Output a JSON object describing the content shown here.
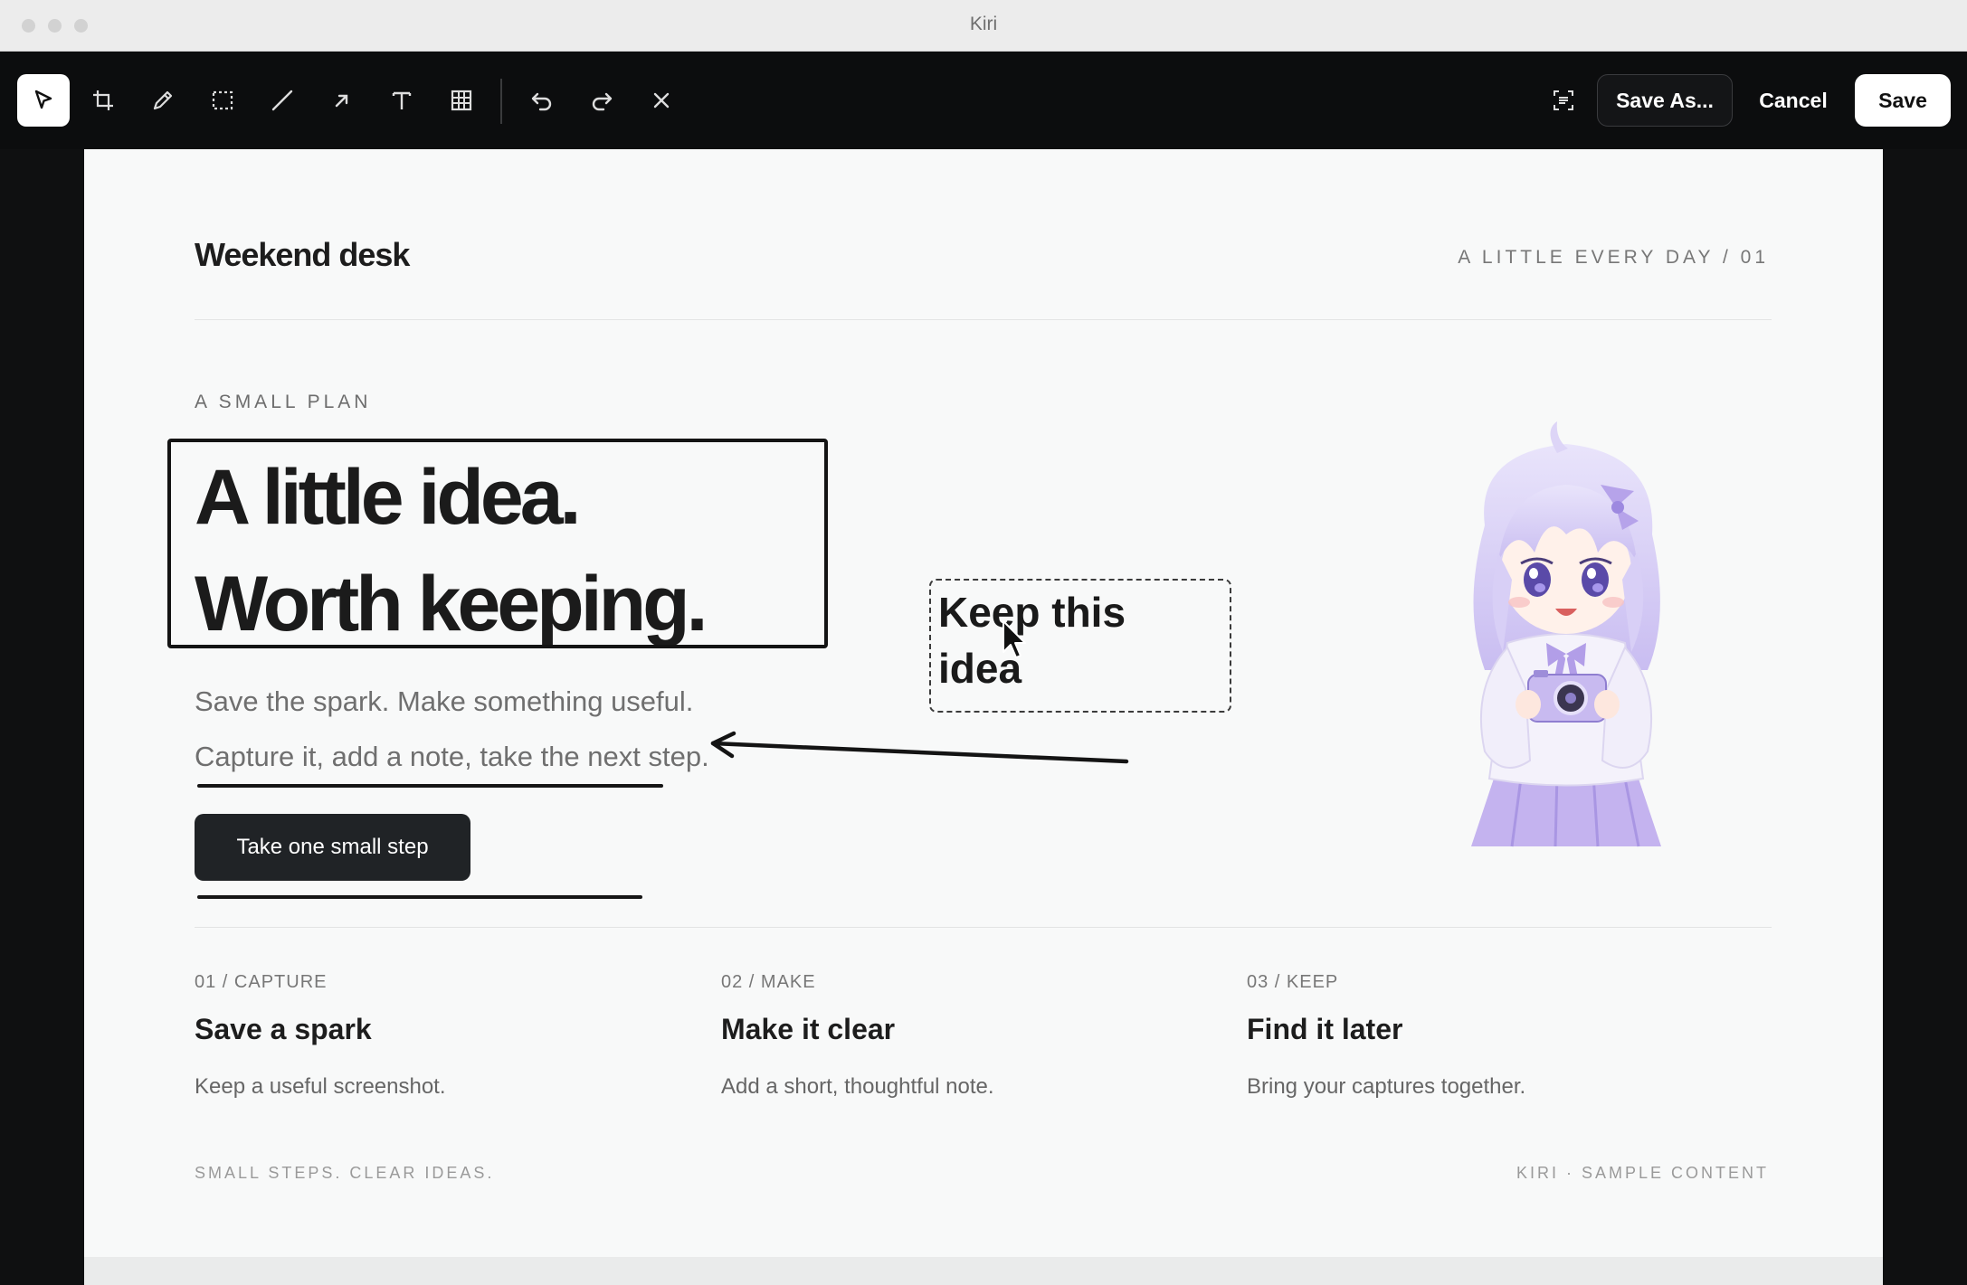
{
  "window": {
    "title": "Kiri"
  },
  "toolbar": {
    "tools": [
      "select",
      "crop",
      "pen",
      "rectangle-select",
      "line",
      "arrow",
      "text",
      "table",
      "undo",
      "redo",
      "clear"
    ],
    "active_tool": "select",
    "save_as_label": "Save As...",
    "cancel_label": "Cancel",
    "save_label": "Save"
  },
  "page": {
    "brand": "Weekend desk",
    "issue": "A LITTLE EVERY DAY / 01",
    "eyebrow": "A SMALL PLAN",
    "headline": [
      "A little idea.",
      "Worth keeping."
    ],
    "subtext": [
      "Save the spark. Make something useful.",
      "Capture it, add a note, take the next step."
    ],
    "cta_label": "Take one small step",
    "columns": [
      {
        "label": "01 / CAPTURE",
        "title": "Save a spark",
        "desc": "Keep a useful screenshot."
      },
      {
        "label": "02 / MAKE",
        "title": "Make it clear",
        "desc": "Add a short, thoughtful note."
      },
      {
        "label": "03 / KEEP",
        "title": "Find it later",
        "desc": "Bring your captures together."
      }
    ],
    "footer_left": "SMALL STEPS. CLEAR IDEAS.",
    "footer_right": "KIRI · SAMPLE CONTENT"
  },
  "annotations": {
    "note_text": "Keep this idea"
  },
  "colors": {
    "toolbar_bg": "#0c0d0e",
    "canvas_bg": "#0f1011",
    "page_bg": "#f8f9f9",
    "cta_bg": "#202326",
    "illustration_accent": "#b8a7ea"
  }
}
